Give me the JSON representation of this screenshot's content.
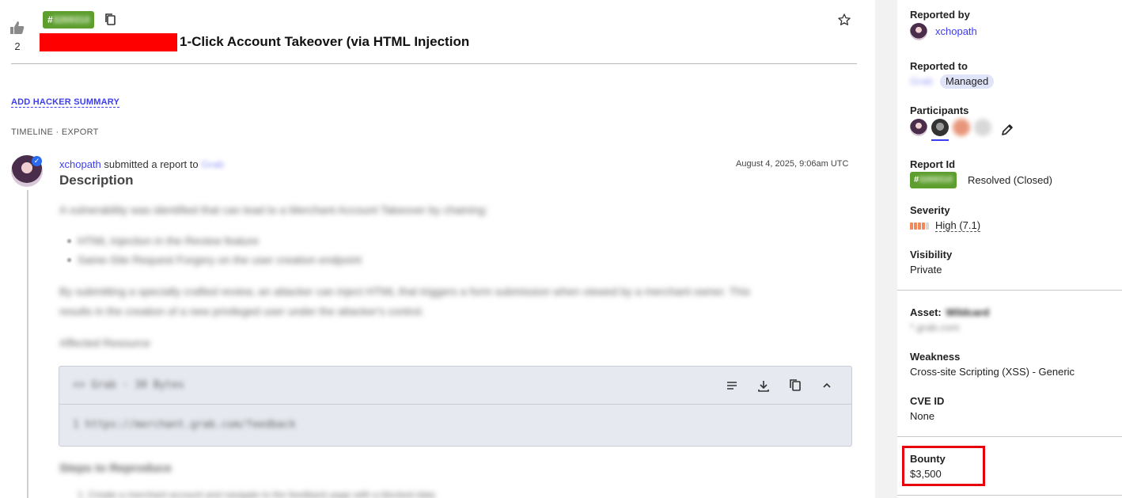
{
  "report": {
    "upvote_count": "2",
    "id_prefix": "#",
    "id_hidden": "3269310",
    "title": "1-Click Account Takeover (via HTML Injection"
  },
  "actions": {
    "add_hacker_summary": "ADD HACKER SUMMARY",
    "timeline": "TIMELINE",
    "separator": " · ",
    "export": "EXPORT"
  },
  "activity": {
    "username": "xchopath",
    "action_text": " submitted a report to ",
    "program_hidden": "Grab",
    "date": "August 4, 2025, 9:06am UTC",
    "heading": "Description",
    "blurred_paragraph": "A vulnerability was identified that can lead to a Merchant Account Takeover by chaining:",
    "blurred_bullets": [
      "HTML Injection in the Review feature",
      "Same-Site Request Forgery on the user creation endpoint"
    ],
    "blurred_paragraph2": "By submitting a specially crafted review, an attacker can inject HTML that triggers a form submission when viewed by a merchant owner.  This",
    "blurred_paragraph3": "results in the creation of a new privileged user under the attacker's control.",
    "blurred_affected": "Affected Resource",
    "code_file": "<> Grab · 30 Bytes",
    "code_line": "1  https://merchant.grab.com/feedback",
    "blurred_steps": "Steps to Reproduce",
    "blurred_step1": "1. Create a merchant account and navigate to the feedback page with a blocked data"
  },
  "sidebar": {
    "reported_by_label": "Reported by",
    "reported_by_user": "xchopath",
    "reported_to_label": "Reported to",
    "reported_to_hidden": "Grab",
    "reported_to_badge": "Managed",
    "participants_label": "Participants",
    "report_id_label": "Report Id",
    "report_id_prefix": "#",
    "report_id_hidden": "3269310",
    "report_status": "Resolved (Closed)",
    "severity_label": "Severity",
    "severity_value": "High (7.1)",
    "visibility_label": "Visibility",
    "visibility_value": "Private",
    "asset_label": "Asset:",
    "asset_hidden": "Wildcard",
    "asset_hidden_sub": "*.grab.com",
    "weakness_label": "Weakness",
    "weakness_value": "Cross-site Scripting (XSS) - Generic",
    "cve_label": "CVE ID",
    "cve_value": "None",
    "bounty_label": "Bounty",
    "bounty_value": "$3,500"
  },
  "colors": {
    "accent_link": "#3d3df0",
    "badge_green": "#5d9e2f",
    "redaction_red": "#ff0000",
    "severity_high": "#f08a5d",
    "highlight_box": "#e8000d"
  },
  "icons": [
    "thumbs-up-icon",
    "copy-icon",
    "star-icon",
    "verified-icon",
    "wrap-lines-icon",
    "download-icon",
    "copy-code-icon",
    "chevron-up-icon",
    "edit-pencil-icon"
  ]
}
